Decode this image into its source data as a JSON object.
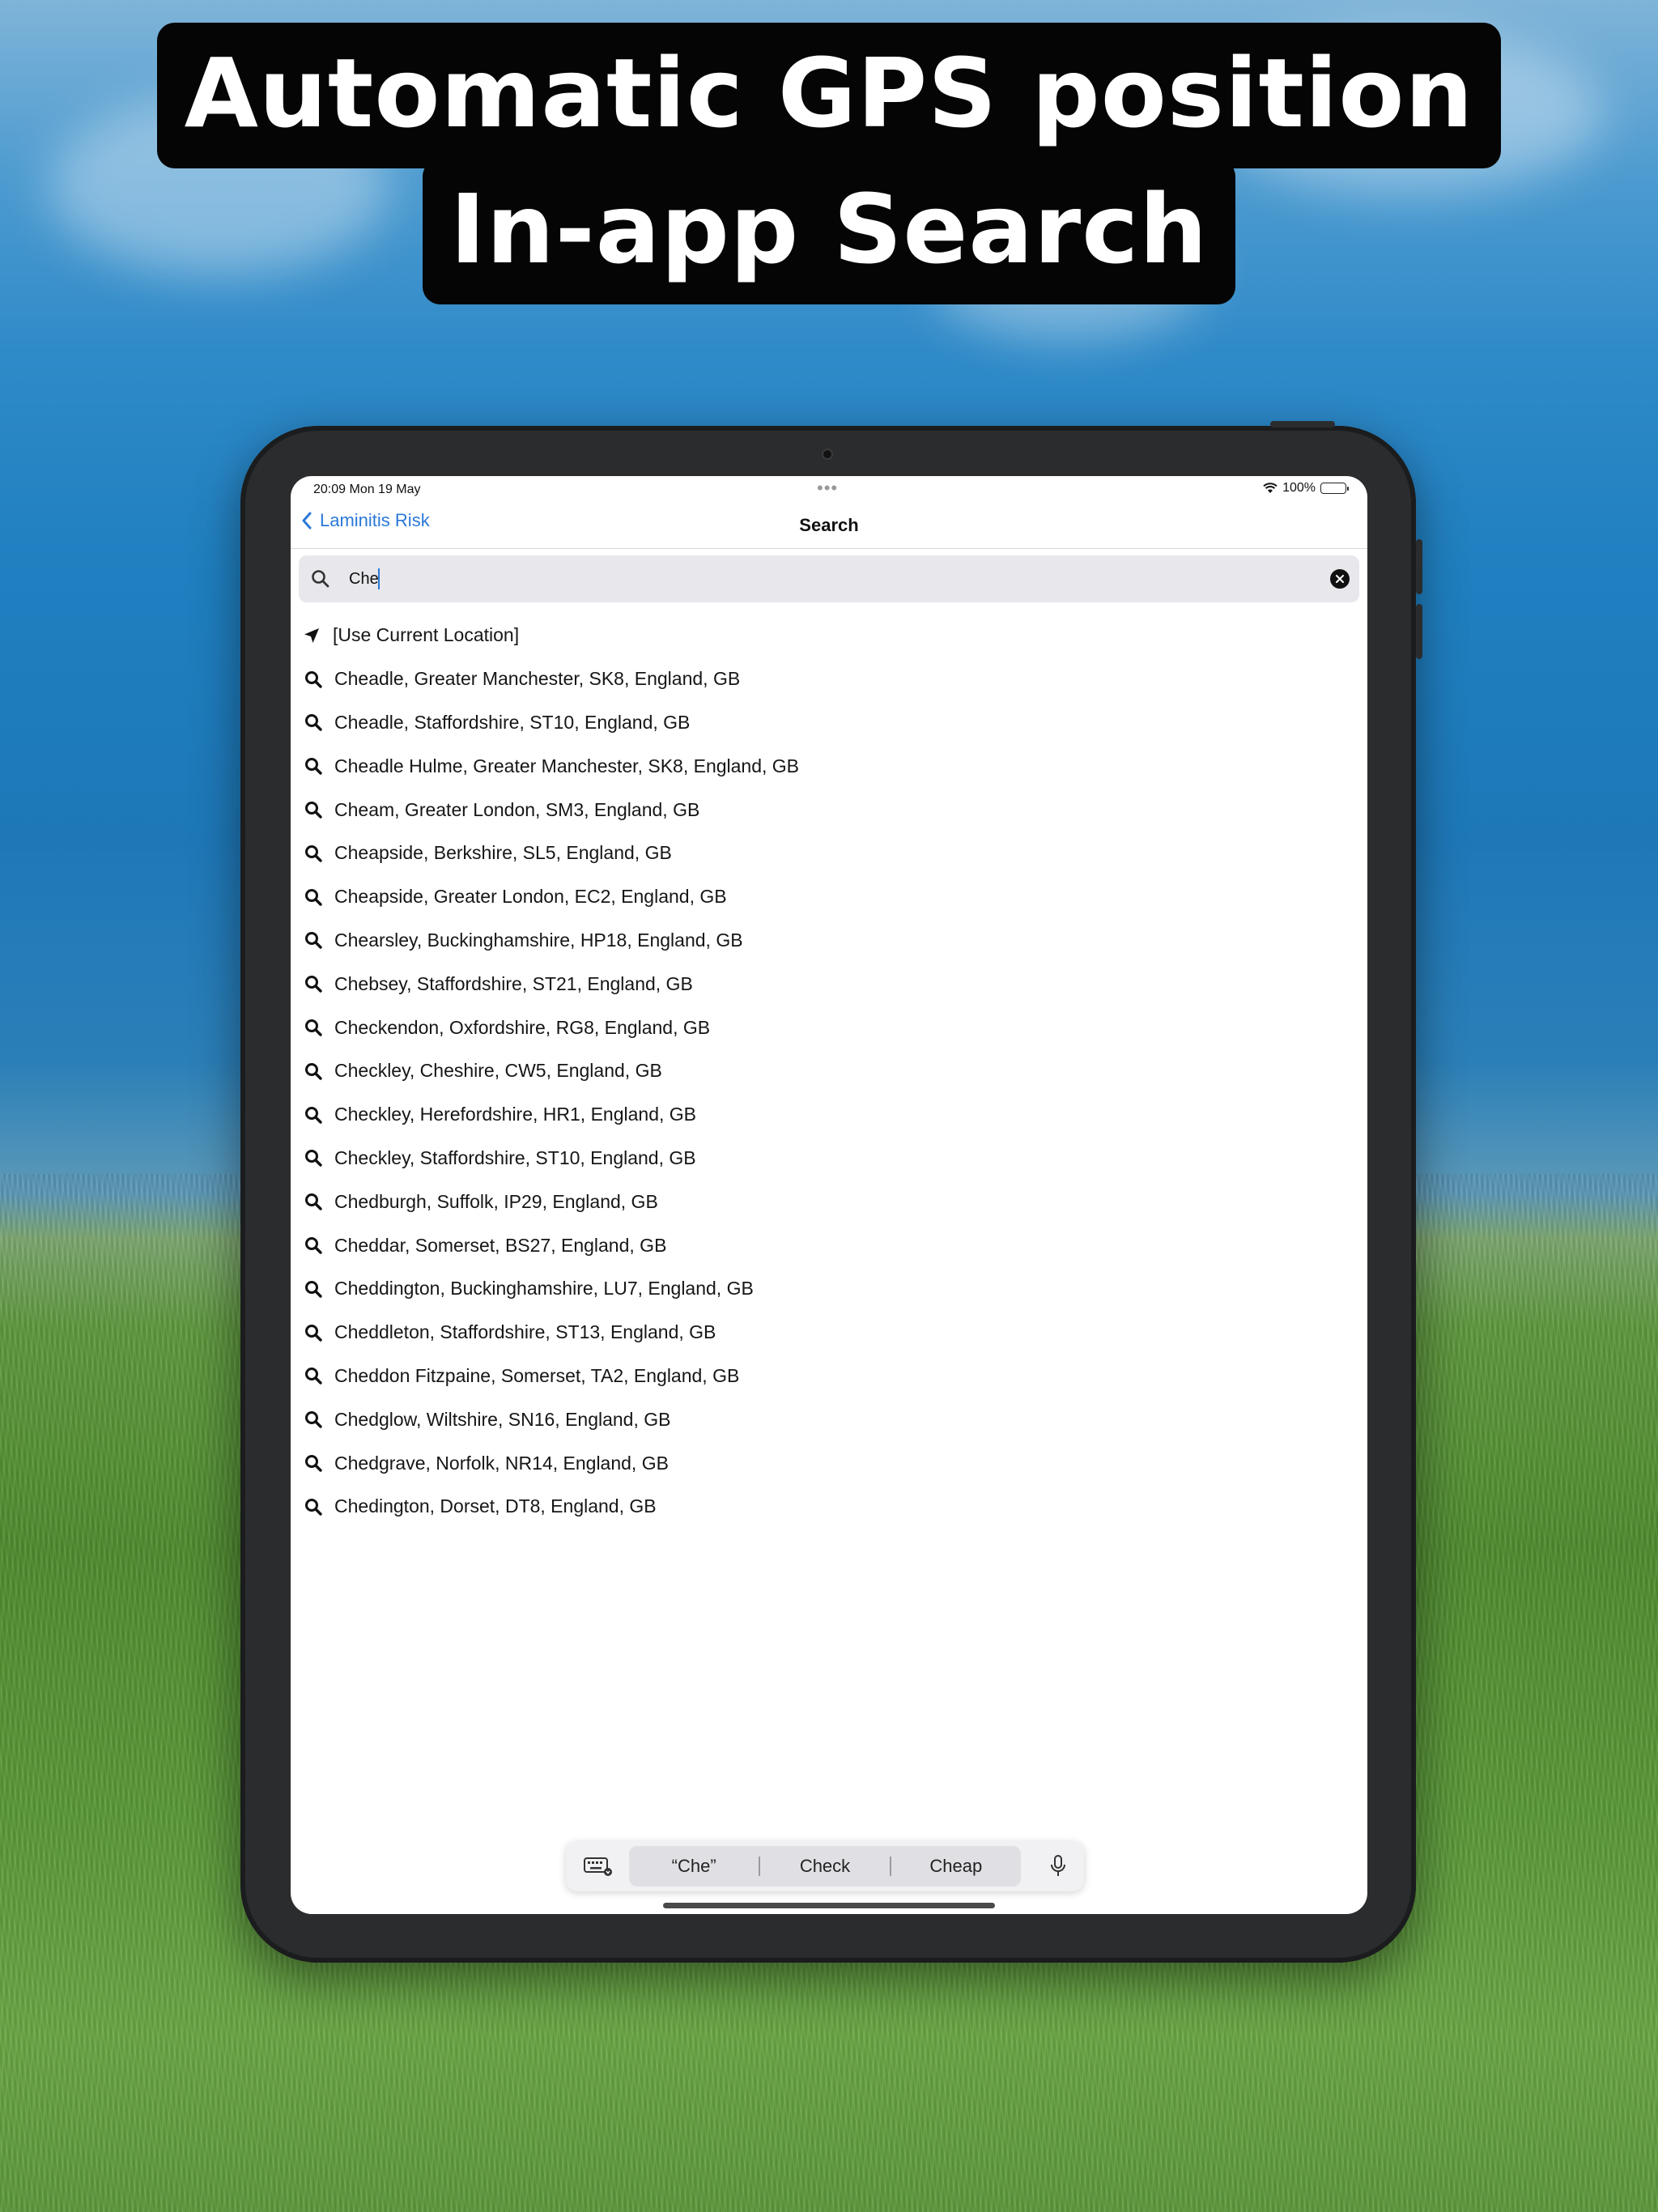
{
  "headline": {
    "line1": "Automatic GPS position",
    "line2": "In-app Search"
  },
  "status_bar": {
    "time": "20:09   Mon 19 May",
    "dots": "•••",
    "battery": "100%"
  },
  "nav": {
    "back_label": "Laminitis Risk",
    "title": "Search"
  },
  "search": {
    "value": "Che"
  },
  "current_location_label": "[Use Current Location]",
  "results": [
    "Cheadle, Greater Manchester, SK8, England, GB",
    "Cheadle, Staffordshire, ST10, England, GB",
    "Cheadle Hulme, Greater Manchester, SK8, England, GB",
    "Cheam, Greater London, SM3, England, GB",
    "Cheapside, Berkshire, SL5, England, GB",
    "Cheapside, Greater London, EC2, England, GB",
    "Chearsley, Buckinghamshire, HP18, England, GB",
    "Chebsey, Staffordshire, ST21, England, GB",
    "Checkendon, Oxfordshire, RG8, England, GB",
    "Checkley, Cheshire, CW5, England, GB",
    "Checkley, Herefordshire, HR1, England, GB",
    "Checkley, Staffordshire, ST10, England, GB",
    "Chedburgh, Suffolk, IP29, England, GB",
    "Cheddar, Somerset, BS27, England, GB",
    "Cheddington, Buckinghamshire, LU7, England, GB",
    "Cheddleton, Staffordshire, ST13, England, GB",
    "Cheddon Fitzpaine, Somerset, TA2, England, GB",
    "Chedglow, Wiltshire, SN16, England, GB",
    "Chedgrave, Norfolk, NR14, England, GB",
    "Chedington, Dorset, DT8, England, GB"
  ],
  "keyboard_suggestions": [
    "“Che”",
    "Check",
    "Cheap"
  ],
  "icons": {
    "back": "chevron-left-icon",
    "search": "magnifier-icon",
    "clear": "clear-circle-icon",
    "location": "location-arrow-icon",
    "keyboard": "keyboard-icon",
    "mic": "microphone-icon"
  },
  "colors": {
    "accent": "#2a78d8",
    "headline_bg": "#050505",
    "search_field_bg": "#e7e7ec"
  }
}
